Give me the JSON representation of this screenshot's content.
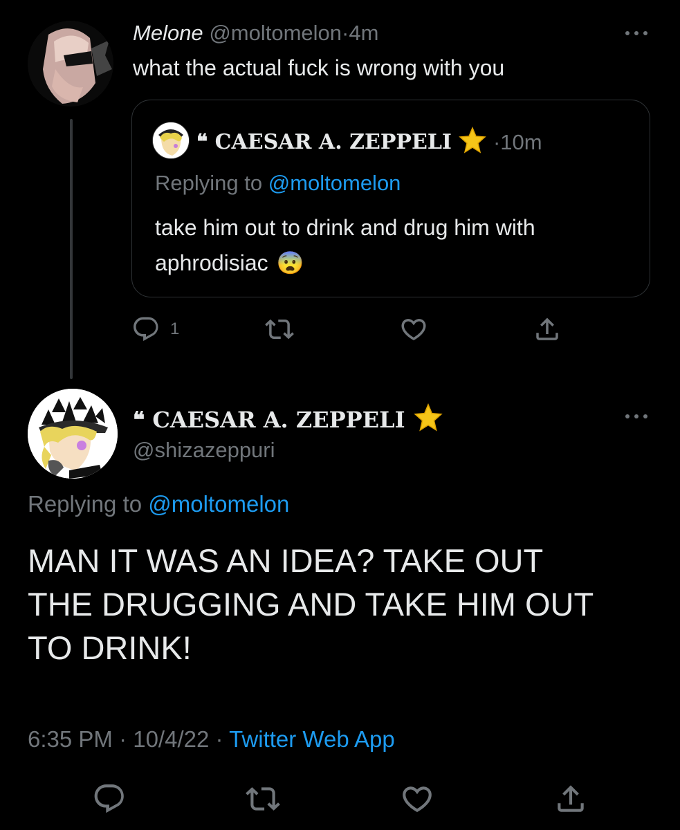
{
  "tweet1": {
    "display_name": "Melone",
    "handle": "@moltomelon",
    "separator": "·",
    "time": "4m",
    "text": "what the actual fuck is wrong with you",
    "quote": {
      "display_name": "❝ CAESAR A. ZEPPELI",
      "name_emoji": "star",
      "separator": "·",
      "time": "10m",
      "replying_prefix": "Replying to",
      "replying_handle": "@moltomelon",
      "text_line1": "take him out to drink and drug him with",
      "text_line2": "aphrodisiac",
      "text_emoji": "😨"
    },
    "actions": {
      "reply_count": "1"
    }
  },
  "tweet2": {
    "display_name": "❝ CAESAR A. ZEPPELI",
    "name_emoji": "star",
    "handle": "@shizazeppuri",
    "replying_prefix": "Replying to",
    "replying_handle": "@moltomelon",
    "text_line1": "MAN IT WAS AN IDEA? TAKE OUT",
    "text_line2": "THE DRUGGING AND TAKE HIM OUT",
    "text_line3": "TO DRINK!",
    "timestamp": "6:35 PM · 10/4/22 · ",
    "source": "Twitter Web App"
  },
  "colors": {
    "background": "#000000",
    "text": "#e7e9ea",
    "muted": "#71767b",
    "link": "#1d9bf0",
    "star": "#f5c518"
  }
}
